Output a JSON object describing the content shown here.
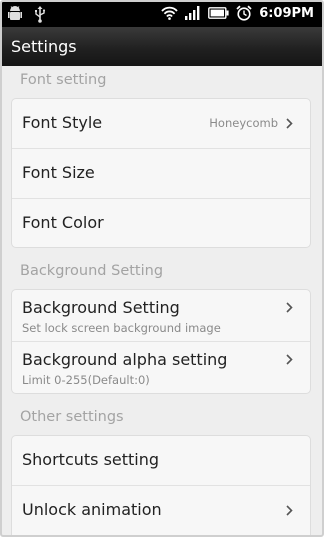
{
  "status_bar": {
    "time": "6:09PM",
    "icons": [
      "android-debug-icon",
      "usb-icon",
      "wifi-icon",
      "signal-icon",
      "battery-icon",
      "alarm-icon"
    ]
  },
  "title_bar": {
    "title": "Settings"
  },
  "sections": [
    {
      "header": "Font setting",
      "items": [
        {
          "label": "Font Style",
          "value": "Honeycomb",
          "chevron": true
        },
        {
          "label": "Font Size"
        },
        {
          "label": "Font Color"
        }
      ]
    },
    {
      "header": "Background Setting",
      "items": [
        {
          "label": "Background Setting",
          "subtitle": "Set lock screen background image",
          "chevron": true
        },
        {
          "label": "Background alpha setting",
          "subtitle": "Limit 0-255(Default:0)",
          "chevron": true
        }
      ]
    },
    {
      "header": "Other settings",
      "items": [
        {
          "label": "Shortcuts setting"
        },
        {
          "label": "Unlock animation",
          "chevron": true
        }
      ]
    }
  ],
  "colors": {
    "background": "#eeeeee",
    "card": "#f7f7f7",
    "section_header": "#a3a3a3",
    "titlebar": "#1f1f1f"
  }
}
